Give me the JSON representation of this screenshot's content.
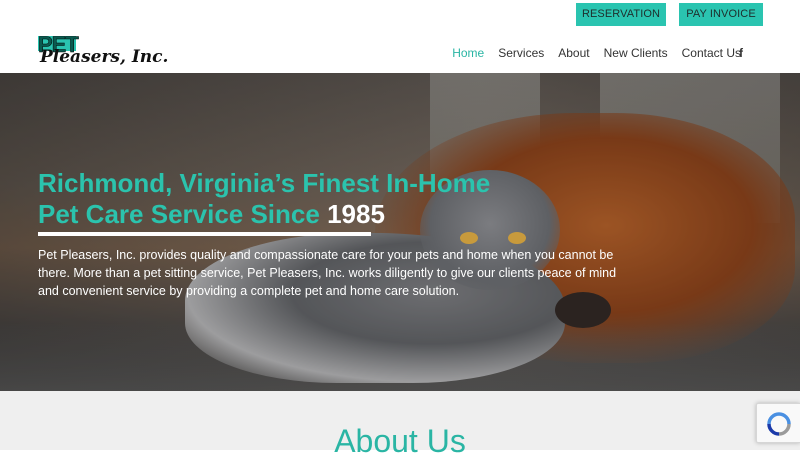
{
  "header": {
    "buttons": {
      "reservation": "RESERVATION",
      "pay_invoice": "PAY INVOICE"
    },
    "logo": {
      "line1": "PET",
      "line2": "Pleasers, Inc."
    },
    "nav": {
      "items": [
        "Home",
        "Services",
        "About",
        "New Clients",
        "Contact Us"
      ],
      "active": "Home",
      "facebook_icon": "f"
    }
  },
  "hero": {
    "title_line1": "Richmond, Virginia’s Finest In-Home",
    "title_line2": "Pet Care Service Since ",
    "title_year": "1985",
    "description": "Pet Pleasers, Inc. provides quality and compassionate care for your pets and home when you cannot be there. More than a pet sitting service, Pet Pleasers, Inc. works diligently to give our clients peace of mind and convenient service by providing a complete pet and home care solution."
  },
  "about": {
    "title": "About Us"
  },
  "colors": {
    "accent": "#2ac4b0",
    "nav_active": "#2ab5a4",
    "hero_year": "#ffffff"
  },
  "icons": [
    "facebook-icon",
    "recaptcha-icon"
  ]
}
